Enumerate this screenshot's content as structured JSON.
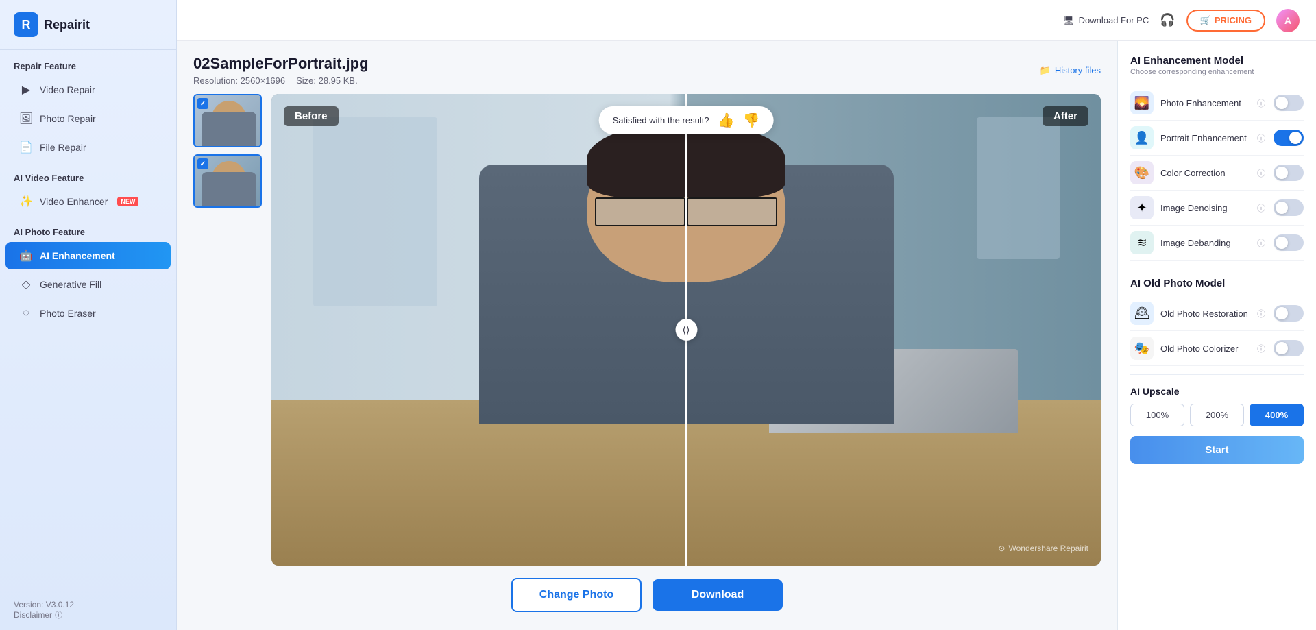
{
  "app": {
    "name": "Repairit",
    "logo_char": "R",
    "version": "Version: V3.0.12"
  },
  "topbar": {
    "download_pc": "Download For PC",
    "pricing": "PRICING",
    "avatar_char": "A"
  },
  "sidebar": {
    "repair_feature_label": "Repair Feature",
    "items_repair": [
      {
        "id": "video-repair",
        "label": "Video Repair",
        "icon": "▶"
      },
      {
        "id": "photo-repair",
        "label": "Photo Repair",
        "icon": "🖼"
      },
      {
        "id": "file-repair",
        "label": "File Repair",
        "icon": "📄"
      }
    ],
    "ai_video_label": "AI Video Feature",
    "items_ai_video": [
      {
        "id": "video-enhancer",
        "label": "Video Enhancer",
        "icon": "✨",
        "badge": "NEW"
      }
    ],
    "ai_photo_label": "AI Photo Feature",
    "items_ai_photo": [
      {
        "id": "ai-enhancement",
        "label": "AI Enhancement",
        "icon": "🤖",
        "active": true
      },
      {
        "id": "generative-fill",
        "label": "Generative Fill",
        "icon": "◇"
      },
      {
        "id": "photo-eraser",
        "label": "Photo Eraser",
        "icon": "◌"
      }
    ],
    "disclaimer": "Disclaimer"
  },
  "file": {
    "name": "02SampleForPortrait.jpg",
    "resolution": "Resolution: 2560×1696",
    "size": "Size: 28.95 KB."
  },
  "history": {
    "label": "History files"
  },
  "viewer": {
    "before_label": "Before",
    "after_label": "After",
    "satisfaction_text": "Satisfied with the result?",
    "watermark": "Wondershare Repairit"
  },
  "actions": {
    "change_photo": "Change Photo",
    "download": "Download"
  },
  "right_panel": {
    "ai_enhancement_title": "AI Enhancement Model",
    "ai_enhancement_subtitle": "Choose corresponding enhancement",
    "enhancements": [
      {
        "id": "photo-enhancement",
        "label": "Photo Enhancement",
        "icon": "🌄",
        "icon_class": "icon-blue",
        "enabled": false
      },
      {
        "id": "portrait-enhancement",
        "label": "Portrait Enhancement",
        "icon": "👤",
        "icon_class": "icon-teal",
        "enabled": true
      },
      {
        "id": "color-correction",
        "label": "Color Correction",
        "icon": "🎨",
        "icon_class": "icon-purple",
        "enabled": false
      },
      {
        "id": "image-denoising",
        "label": "Image Denoising",
        "icon": "✦",
        "icon_class": "icon-indigo",
        "enabled": false
      },
      {
        "id": "image-debanding",
        "label": "Image Debanding",
        "icon": "≋",
        "icon_class": "icon-cyan",
        "enabled": false
      }
    ],
    "old_photo_title": "AI Old Photo Model",
    "old_photo_items": [
      {
        "id": "old-photo-restoration",
        "label": "Old Photo Restoration",
        "icon": "🕰",
        "icon_class": "icon-blue",
        "enabled": false
      },
      {
        "id": "old-photo-colorizer",
        "label": "Old Photo Colorizer",
        "icon": "🎭",
        "icon_class": "icon-gray",
        "enabled": false
      }
    ],
    "upscale_title": "AI Upscale",
    "upscale_options": [
      "100%",
      "200%",
      "400%"
    ],
    "upscale_active": "400%",
    "start_label": "Start"
  }
}
